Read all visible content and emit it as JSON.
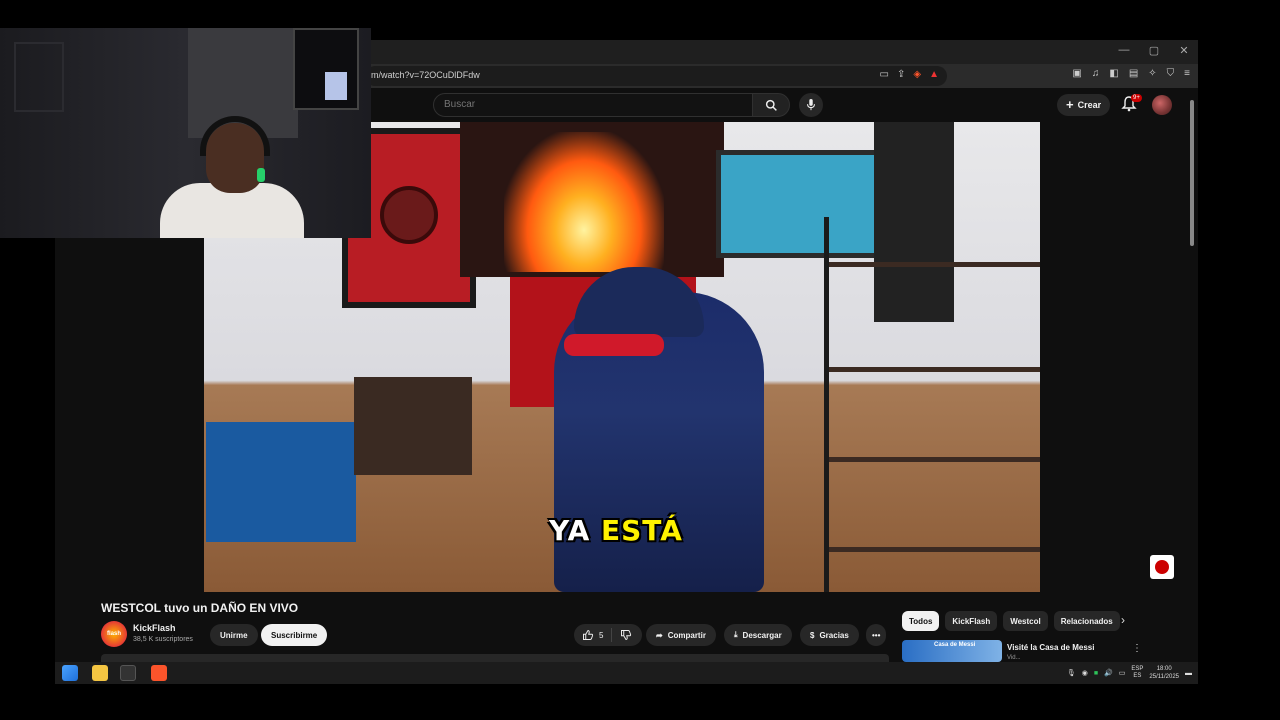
{
  "browser": {
    "url": "m/watch?v=72OCuDlDFdw",
    "window_controls": [
      "—",
      "▢",
      "✕"
    ]
  },
  "header": {
    "search_placeholder": "Buscar",
    "create_label": "Crear",
    "notif_badge": "9+"
  },
  "video": {
    "caption_part1": "YA",
    "caption_part2": "ESTÁ"
  },
  "meta": {
    "title": "WESTCOL tuvo un DAÑO EN VIVO",
    "channel_name": "KickFlash",
    "channel_avatar_text": "flash",
    "subscribers": "38,5 K suscriptores",
    "join_label": "Unirme",
    "subscribe_label": "Suscribirme",
    "likes": "5",
    "share_label": "Compartir",
    "download_label": "Descargar",
    "thanks_label": "Gracias"
  },
  "chips": [
    "Todos",
    "KickFlash",
    "Westcol",
    "Relacionados"
  ],
  "recommendation": {
    "thumb_text": "Casa de Messi",
    "title": "Visité la Casa de Messi",
    "meta": "Vid..."
  },
  "tray": {
    "lang_line1": "ESP",
    "lang_line2": "ES",
    "time": "18:00",
    "date": "25/11/2025"
  },
  "colors": {
    "accent_red": "#cc0000",
    "caption_yellow": "#fff200",
    "background": "#0f0f0f"
  }
}
